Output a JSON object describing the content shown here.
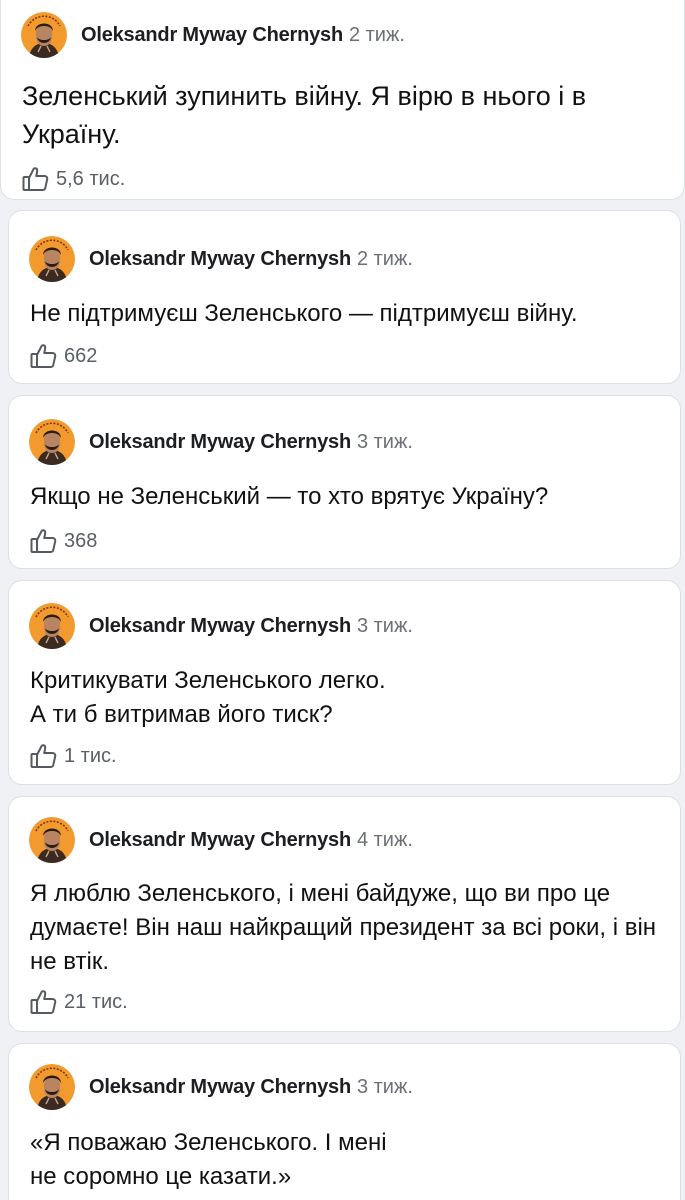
{
  "colors": {
    "page_background": "#f0f1f4",
    "card_background": "#ffffff",
    "avatar_background": "#f39a2e",
    "author_text": "#1c1e21",
    "meta_text": "#6b6f76"
  },
  "icons": {
    "avatar": "author-avatar",
    "like": "thumbs-up-outline-icon"
  },
  "comments": [
    {
      "author": "Oleksandr Myway Chernysh",
      "time": "2 тиж.",
      "text": "Зеленський зупинить війну. Я вірю в нього і в Україну.",
      "likes": "5,6 тис."
    },
    {
      "author": "Oleksandr Myway Chernysh",
      "time": "2 тиж.",
      "text": "Не підтримуєш Зеленського — підтримуєш війну.",
      "likes": "662"
    },
    {
      "author": "Oleksandr Myway Chernysh",
      "time": "3 тиж.",
      "text": "Якщо не Зеленський — то хто врятує Україну?",
      "likes": "368"
    },
    {
      "author": "Oleksandr Myway Chernysh",
      "time": "3 тиж.",
      "text": "Критикувати Зеленського легко.\nА ти б витримав його тиск?",
      "likes": "1 тис."
    },
    {
      "author": "Oleksandr Myway Chernysh",
      "time": "4 тиж.",
      "text": "Я люблю Зеленського, і мені байдуже, що ви про це думаєте! Він наш найкращий президент за всі роки, і він не втік.",
      "likes": "21 тис."
    },
    {
      "author": "Oleksandr Myway Chernysh",
      "time": "3 тиж.",
      "text": "«Я поважаю Зеленського. І мені\nне соромно це казати.»",
      "likes": ""
    }
  ]
}
